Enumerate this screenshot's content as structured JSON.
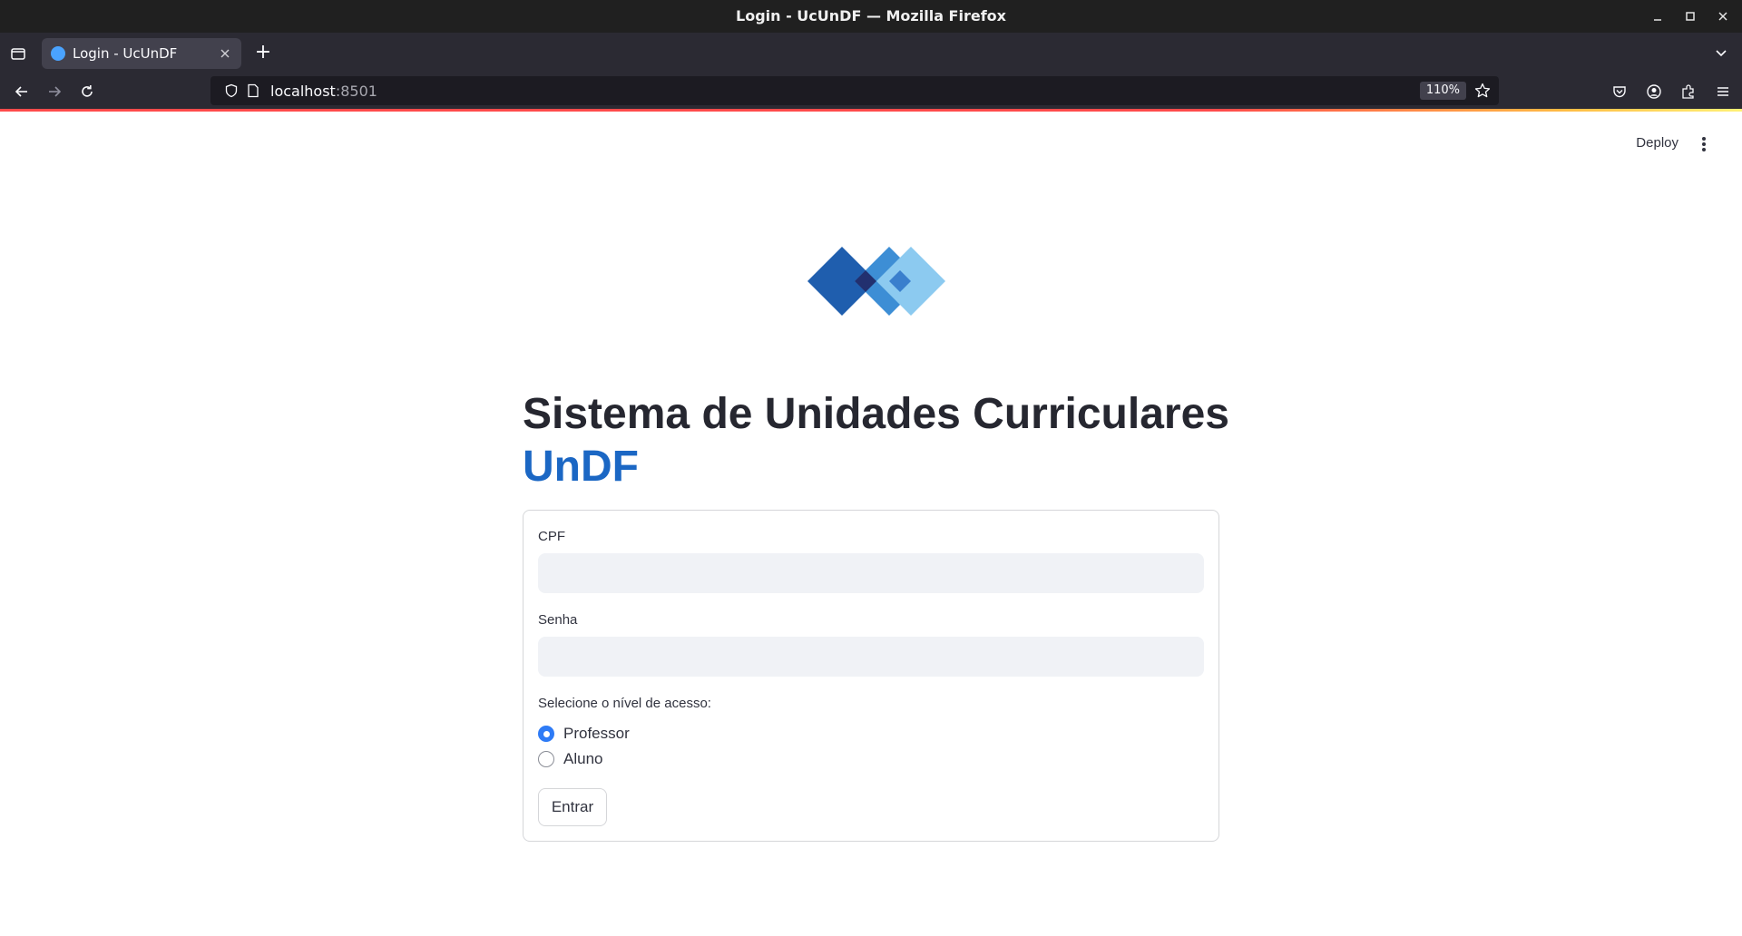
{
  "window": {
    "title": "Login - UcUnDF — Mozilla Firefox"
  },
  "tabs": [
    {
      "label": "Login - UcUnDF",
      "favicon": "streamlit-favicon"
    }
  ],
  "address_bar": {
    "host": "localhost",
    "port": ":8501",
    "zoom": "110%"
  },
  "app_header": {
    "deploy_label": "Deploy"
  },
  "page": {
    "title": "Sistema de Unidades Curriculares",
    "title_highlight": "UnDF",
    "logo": "undf-diamond-logo"
  },
  "form": {
    "cpf_label": "CPF",
    "cpf_value": "",
    "password_label": "Senha",
    "password_value": "",
    "access_label": "Selecione o nível de acesso:",
    "access_options": [
      {
        "label": "Professor",
        "selected": true
      },
      {
        "label": "Aluno",
        "selected": false
      }
    ],
    "submit_label": "Entrar"
  },
  "colors": {
    "brand_blue": "#1b67c4",
    "radio_selected": "#2e7bf6",
    "input_bg": "#f0f2f6",
    "text_dark": "#262730"
  }
}
